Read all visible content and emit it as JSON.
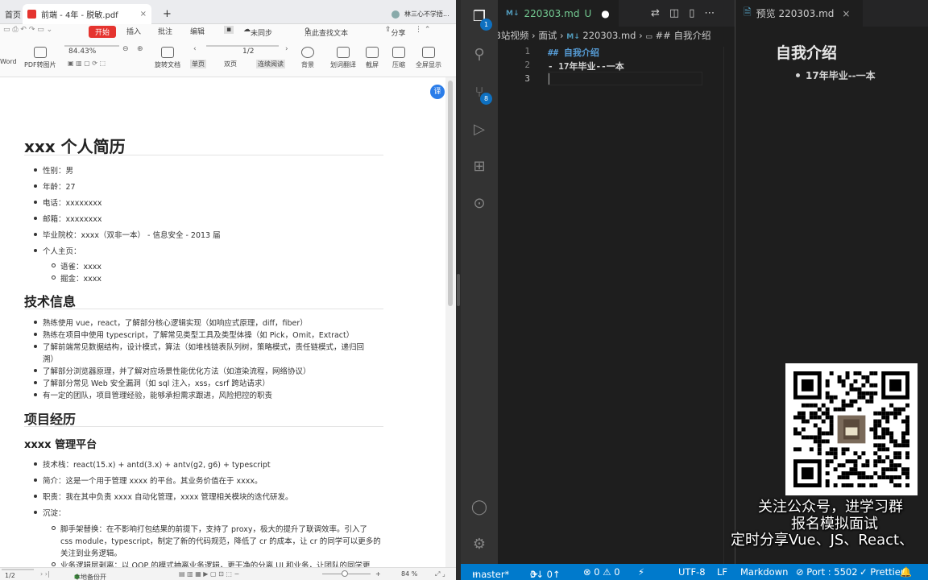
{
  "pdf_viewer": {
    "tabs": [
      {
        "label": "首页"
      },
      {
        "label": "前端 - 4年 - 脱敏.pdf"
      }
    ],
    "new_tab": "+",
    "user_label": "林三心不学捂...",
    "menu": {
      "start": "开始",
      "insert": "插入",
      "annotate": "批注",
      "edit": "编辑",
      "sync": "未同步",
      "search": "点此查找文本",
      "share": "分享"
    },
    "zoom": "84.43%",
    "page_input": "1/2",
    "tools": [
      "Word",
      "PDF转图片",
      "旋转文档",
      "单页",
      "双页",
      "连续阅读",
      "背景",
      "划词翻译",
      "截屏",
      "压缩",
      "全屏显示"
    ],
    "status": {
      "page": "1/2",
      "open_local": "本地备份开",
      "zoom": "84 %"
    },
    "document": {
      "title": "xxx 个人简历",
      "basic_info": [
        "性别：男",
        "年龄：27",
        "电话：xxxxxxxx",
        "邮箱：xxxxxxxx",
        "毕业院校：xxxx（双非一本） - 信息安全 - 2013 届",
        "个人主页："
      ],
      "homepages": [
        "语雀：xxxx",
        "掘金：xxxx"
      ],
      "section_tech": "技术信息",
      "tech": [
        "熟练使用 vue，react，了解部分核心逻辑实现（如响应式原理，diff，fiber）",
        "熟练在项目中使用 typescript，了解常见类型工具及类型体操（如 Pick，Omit，Extract）",
        "了解前端常见数据结构，设计模式，算法（如堆栈链表队列树，策略模式，责任链模式，递归回",
        "溯）",
        "了解部分浏览器原理，并了解对应场景性能优化方法（如渲染流程，网络协议）",
        "了解部分常见 Web 安全漏洞（如 sql 注入，xss，csrf 跨站请求）",
        "有一定的团队，项目管理经验，能够承担需求跟进，风险把控的职责"
      ],
      "section_projects": "项目经历",
      "project_title": "xxxx 管理平台",
      "project": [
        "技术栈：react(15.x) + antd(3.x) + antv(g2, g6) + typescript",
        "简介：这是一个用于管理 xxxx 的平台。其业务价值在于 xxxx。",
        "职责：我在其中负责 xxxx 自动化管理，xxxx 管理相关模块的迭代研发。",
        "沉淀："
      ],
      "project_sub": [
        "脚手架替换：在不影响打包结果的前提下，支持了 proxy，极大的提升了联调效率。引入了",
        "css module，typescript，制定了新的代码规范，降低了 cr 的成本，让 cr 的同学可以更多的",
        "关注到业务逻辑。",
        "业务逻辑层剥离：以 OOP 的模式抽离业务逻辑，更干净的分离 UI 和业务，让团队的同学更"
      ]
    }
  },
  "vscode": {
    "activity_badges": {
      "explorer": "1",
      "scm": "8"
    },
    "tabs": [
      {
        "label": "220303.md",
        "status": "U",
        "modified": "●"
      },
      {
        "label": "预览 220303.md",
        "close": "×"
      }
    ],
    "breadcrumb": [
      "B站视频",
      "面试",
      "220303.md",
      "## 自我介绍"
    ],
    "breadcrumb_md_prefix": "M↓",
    "lines": [
      {
        "num": "1",
        "text": "## 自我介绍"
      },
      {
        "num": "2",
        "text": "- 17年毕业--一本"
      },
      {
        "num": "3",
        "text": ""
      }
    ],
    "preview": {
      "heading": "自我介绍",
      "item": "17年毕业--一本"
    },
    "status": {
      "branch": "master*",
      "sync": "3↓ 0↑",
      "problems": "⊗ 0 ⚠ 0",
      "encoding": "UTF-8",
      "eol": "LF",
      "language": "Markdown",
      "port": "⊘ Port : 5502",
      "prettier": "✓ Prettier"
    }
  },
  "overlay": {
    "line1": "关注公众号，进学习群",
    "line2": "报名模拟面试",
    "line3": "定时分享Vue、JS、React、"
  },
  "colors": {
    "accent": "#007acc",
    "pdf_accent": "#e5342f",
    "md_icon": "#519aba"
  }
}
